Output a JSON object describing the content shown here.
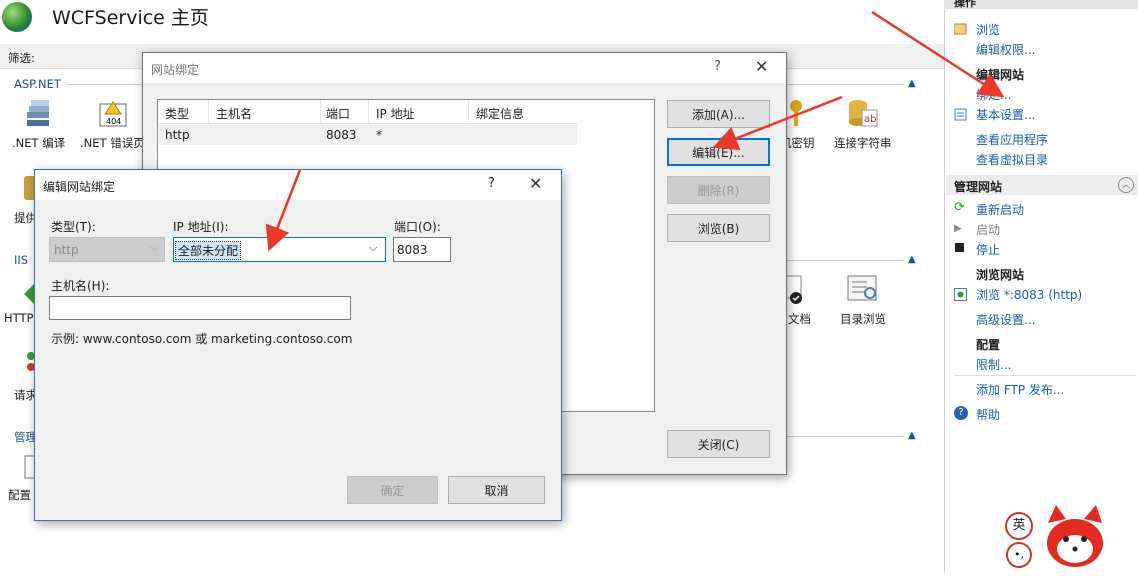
{
  "page": {
    "title": "WCFService 主页",
    "filter_label": "筛选:",
    "sections": {
      "aspnet": "ASP.NET",
      "iis": "IIS",
      "manage": "管理"
    },
    "features_left": {
      "net_compile": ".NET 编译",
      "net_error": ".NET 错误页",
      "provider": "提供",
      "http": "HTTP",
      "request": "请求",
      "config": "配置"
    },
    "features_right": {
      "machine_key": "机密钥",
      "connection_strings": "连接字符串",
      "default_doc": "文档",
      "dir_browse": "目录浏览"
    }
  },
  "right_panel": {
    "header": "操作",
    "items": {
      "browse": "浏览",
      "edit_permissions": "编辑权限...",
      "edit_site_header": "编辑网站",
      "bindings": "绑定...",
      "basic_settings": "基本设置...",
      "view_apps": "查看应用程序",
      "view_vdirs": "查看虚拟目录",
      "manage_site_header": "管理网站",
      "restart": "重新启动",
      "start": "启动",
      "stop": "停止",
      "browse_site_header": "浏览网站",
      "browse_8083": "浏览 *:8083 (http)",
      "advanced": "高级设置...",
      "config_header": "配置",
      "limits": "限制...",
      "add_ftp": "添加 FTP 发布...",
      "help": "帮助"
    }
  },
  "site_bindings": {
    "title": "网站绑定",
    "help": "?",
    "columns": [
      "类型",
      "主机名",
      "端口",
      "IP 地址",
      "绑定信息"
    ],
    "rows": [
      {
        "type": "http",
        "host": "",
        "port": "8083",
        "ip": "*",
        "info": ""
      }
    ],
    "buttons": {
      "add": "添加(A)...",
      "edit": "编辑(E)...",
      "remove": "删除(R)",
      "browse": "浏览(B)",
      "close": "关闭(C)"
    }
  },
  "edit_binding": {
    "title": "编辑网站绑定",
    "help": "?",
    "type_label": "类型(T):",
    "type_value": "http",
    "ip_label": "IP 地址(I):",
    "ip_value": "全部未分配",
    "port_label": "端口(O):",
    "port_value": "8083",
    "host_label": "主机名(H):",
    "host_value": "",
    "example": "示例: www.contoso.com 或 marketing.contoso.com",
    "ok": "确定",
    "cancel": "取消"
  },
  "ime": {
    "lang": "英"
  },
  "colors": {
    "link": "#1a5fb4",
    "focus": "#0078d7",
    "arrow": "#e8392a",
    "selection": "#cce8ff"
  }
}
